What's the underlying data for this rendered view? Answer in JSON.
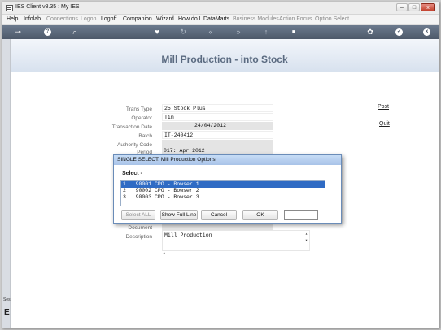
{
  "window": {
    "title": "IES Client v8.35 : My IES",
    "minimize": "–",
    "maximize": "□",
    "close": "x"
  },
  "menu": [
    "Help",
    "Infolab",
    "Connections",
    "Logon",
    "Logoff",
    "Companion",
    "Wizard",
    "How do I",
    "DataMarts",
    "Business Modules",
    "Action Focus",
    "Option Select"
  ],
  "toolbar": {
    "items": [
      {
        "icon": "key-icon",
        "glyph": "⊸"
      },
      {
        "icon": "help-icon",
        "glyph": "?"
      },
      {
        "icon": "search-icon",
        "glyph": "⌕"
      },
      {
        "icon": "heart-icon",
        "glyph": "♥"
      },
      {
        "icon": "refresh-icon",
        "glyph": "↻"
      },
      {
        "icon": "back-icon",
        "glyph": "«"
      },
      {
        "icon": "forward-icon",
        "glyph": "»"
      },
      {
        "icon": "upload-icon",
        "glyph": "↑"
      },
      {
        "icon": "stop-icon",
        "glyph": "■"
      },
      {
        "icon": "settings-icon",
        "glyph": "✿"
      },
      {
        "icon": "ok-icon",
        "glyph": "✓"
      },
      {
        "icon": "close-icon",
        "glyph": "x"
      }
    ]
  },
  "side": {
    "label1": "Ses",
    "label2": "E"
  },
  "form": {
    "title": "Mill Production - into Stock",
    "labels": {
      "trans_type": "Trans Type",
      "operator": "Operator",
      "transaction_date": "Transaction Date",
      "batch": "Batch",
      "authority_code": "Authority Code",
      "period": "Period",
      "document": "Document",
      "description": "Description"
    },
    "values": {
      "trans_type": "25 Stock Plus",
      "operator": "Tim",
      "transaction_date": "24/04/2012",
      "batch": "IT-240412",
      "authority_code": "",
      "period": "017: Apr 2012",
      "document": "",
      "description": "Mill Production"
    },
    "post_label": "Post",
    "quit_label": "Quit"
  },
  "dialog": {
    "title": "SINGLE SELECT: Mill Production Options",
    "prompt": "Select -",
    "items": [
      "1   90001 CPO - Bowser 1",
      "2   90002 CPO - Bowser 2",
      "3   90003 CPO - Bowser 3"
    ],
    "selected_index": 0,
    "buttons": {
      "select_all": "Select ALL",
      "show_full_line": "Show Full Line",
      "cancel": "Cancel",
      "ok": "OK"
    },
    "input_value": ""
  }
}
